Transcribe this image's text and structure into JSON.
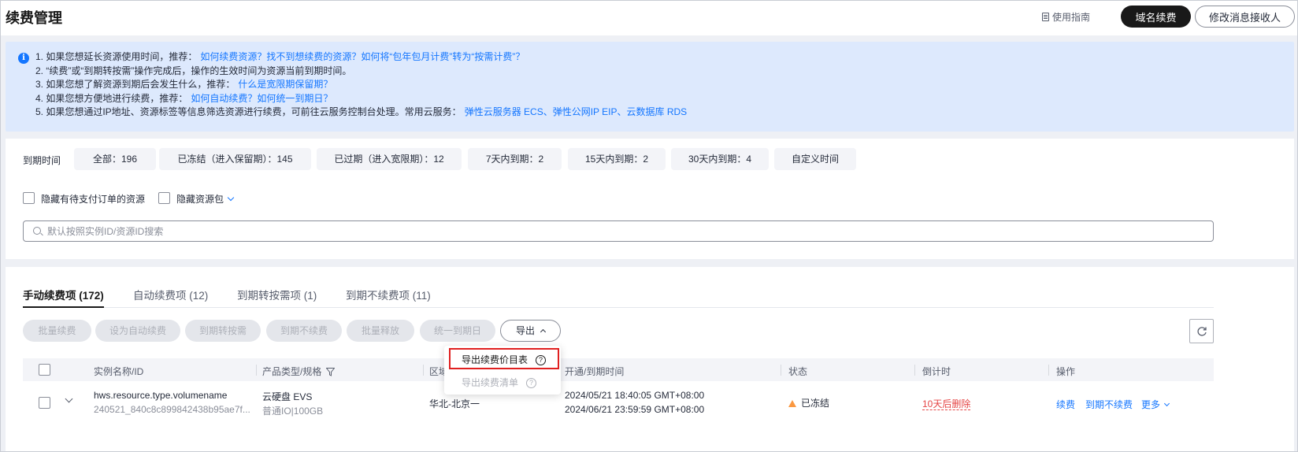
{
  "header": {
    "title": "续费管理",
    "guide_label": "使用指南",
    "renew_domain_button": "域名续费",
    "receiver_button": "修改消息接收人"
  },
  "tip": {
    "lines": [
      {
        "text": "1. 如果您想延长资源使用时间，推荐：",
        "link": "如何续费资源？找不到想续费的资源？如何将“包年包月计费”转为“按需计费”？"
      },
      {
        "text": "2. “续费”或“到期转按需”操作完成后，操作的生效时间为资源当前到期时间。",
        "link": ""
      },
      {
        "text": "3. 如果您想了解资源到期后会发生什么，推荐：",
        "link": "什么是宽限期保留期？"
      },
      {
        "text": "4. 如果您想方便地进行续费，推荐：",
        "link": "如何自动续费？如何统一到期日？"
      },
      {
        "text": "5. 如果您想通过IP地址、资源标签等信息筛选资源进行续费，可前往云服务控制台处理。常用云服务：",
        "link": "弹性云服务器 ECS、弹性公网IP EIP、云数据库 RDS"
      }
    ]
  },
  "filters": {
    "expiry_label": "到期时间",
    "chips": [
      "全部：196",
      "已冻结（进入保留期）：145",
      "已过期（进入宽限期）：12",
      "7天内到期：2",
      "15天内到期：2",
      "30天内到期：4",
      "自定义时间"
    ],
    "hide_unpaid_label": "隐藏有待支付订单的资源",
    "hide_package_label": "隐藏资源包",
    "search_placeholder": "默认按照实例ID/资源ID搜索"
  },
  "tabs": [
    "手动续费项 (172)",
    "自动续费项 (12)",
    "到期转按需项 (1)",
    "到期不续费项 (11)"
  ],
  "toolbar": {
    "buttons": [
      "批量续费",
      "设为自动续费",
      "到期转按需",
      "到期不续费",
      "批量释放",
      "统一到期日"
    ],
    "export_label": "导出"
  },
  "export_menu": {
    "items": [
      "导出续费价目表",
      "导出续费清单"
    ]
  },
  "table": {
    "columns": [
      "实例名称/ID",
      "产品类型/规格",
      "区域",
      "开通/到期时间",
      "状态",
      "倒计时",
      "操作"
    ],
    "rows": [
      {
        "name": "hws.resource.type.volumename",
        "id": "240521_840c8c899842438b95ae7f...",
        "product": "云硬盘 EVS",
        "spec": "普通IO|100GB",
        "region": "华北-北京一",
        "open_time": "2024/05/21 18:40:05 GMT+08:00",
        "expire_time": "2024/06/21 23:59:59 GMT+08:00",
        "status": "已冻结",
        "countdown": "10天后删除",
        "actions": [
          "续费",
          "到期不续费",
          "更多"
        ]
      }
    ]
  }
}
